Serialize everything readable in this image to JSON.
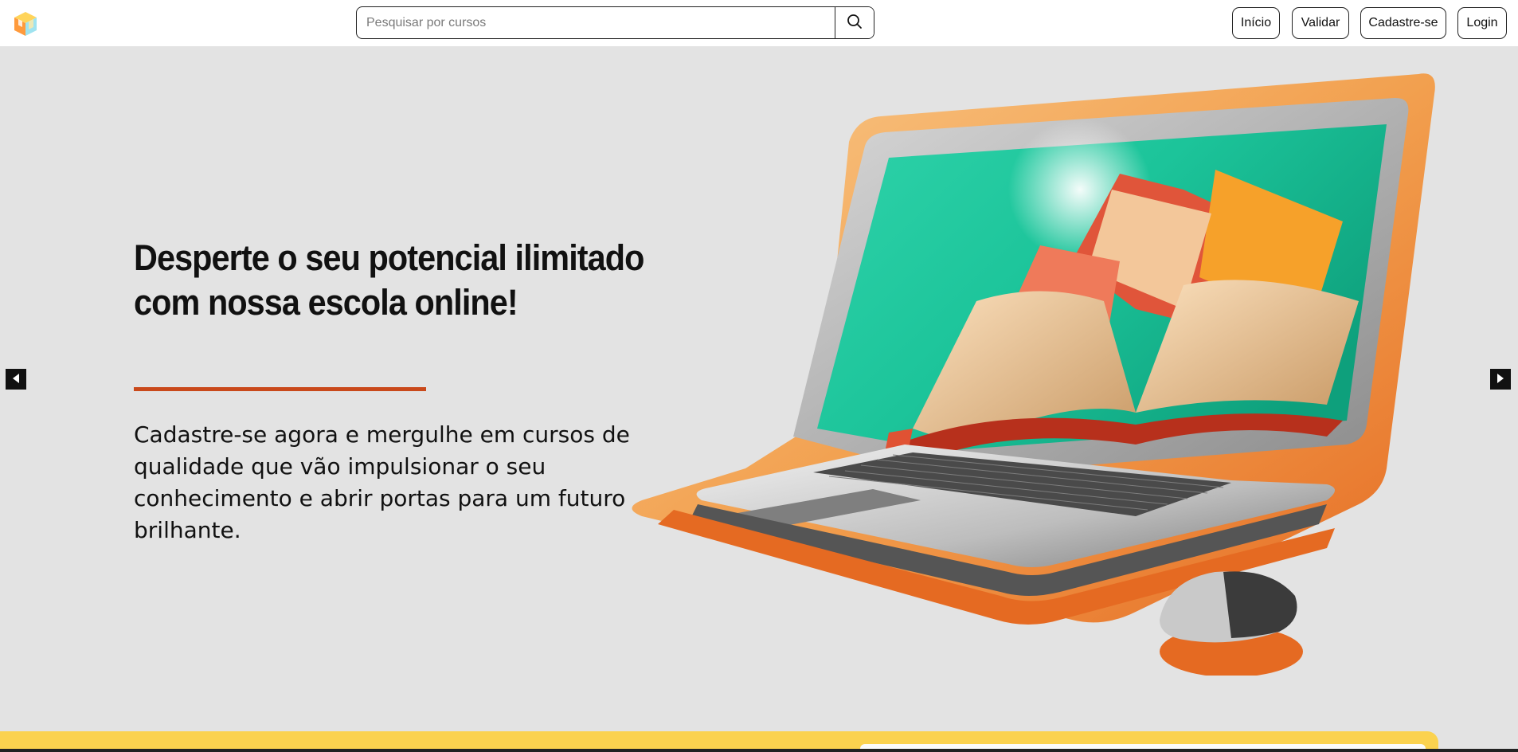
{
  "header": {
    "logo_icon": "cube-logo-icon",
    "search": {
      "placeholder": "Pesquisar por cursos",
      "value": ""
    },
    "search_icon": "search-icon",
    "nav": [
      {
        "label": "Início"
      },
      {
        "label": "Validar"
      },
      {
        "label": "Cadastre-se"
      },
      {
        "label": "Login"
      }
    ]
  },
  "hero": {
    "title": "Desperte o seu potencial ilimitado com nossa escola online!",
    "text": "Cadastre-se agora e mergulhe em cursos de qualidade que vão impulsionar o seu conhecimento e abrir portas para um futuro brilhante.",
    "illustration_icon": "laptop-books-illustration",
    "prev_icon": "caret-left-icon",
    "next_icon": "caret-right-icon"
  },
  "colors": {
    "background": "#e3e3e3",
    "accent_rule": "#c9491b",
    "orange": "#f08a3a",
    "yellow_band": "#fbd24f",
    "screen_teal": "#1cc49a"
  }
}
